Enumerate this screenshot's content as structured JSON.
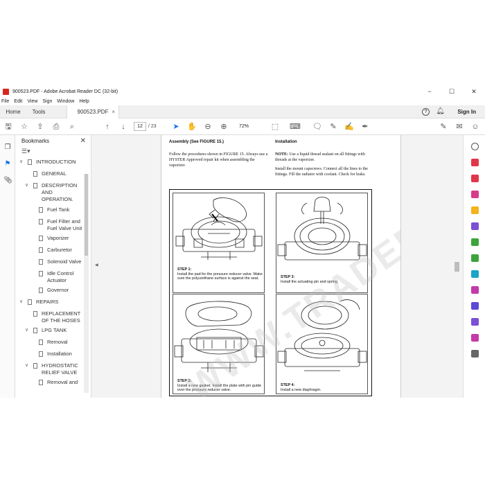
{
  "window": {
    "title": "900523.PDF - Adobe Acrobat Reader DC (32-bit)",
    "min": "−",
    "max": "☐",
    "close": "✕"
  },
  "menu": [
    "File",
    "Edit",
    "View",
    "Sign",
    "Window",
    "Help"
  ],
  "tabs": {
    "home": "Home",
    "tools": "Tools",
    "document": "900523.PDF",
    "close": "×"
  },
  "header": {
    "help": "?",
    "sign_in": "Sign In"
  },
  "toolbar": {
    "page_current": "12",
    "page_total": "/ 23",
    "zoom": "72%"
  },
  "bookmarks": {
    "title": "Bookmarks",
    "items": [
      {
        "label": "INTRODUCTION",
        "level": 0,
        "expanded": true
      },
      {
        "label": "GENERAL",
        "level": 1
      },
      {
        "label": "DESCRIPTION AND OPERATION.",
        "level": 1,
        "expanded": true
      },
      {
        "label": "Fuel Tank",
        "level": 2
      },
      {
        "label": "Fuel Filter and Fuel Valve Unit",
        "level": 2
      },
      {
        "label": "Vaporizer",
        "level": 2
      },
      {
        "label": "Carburetor",
        "level": 2
      },
      {
        "label": "Solenoid Valve",
        "level": 2
      },
      {
        "label": "Idle Control Actuator",
        "level": 2
      },
      {
        "label": "Governor",
        "level": 2
      },
      {
        "label": "REPAIRS",
        "level": 0,
        "expanded": true
      },
      {
        "label": "REPLACEMENT OF THE HOSES",
        "level": 1
      },
      {
        "label": "LPG TANK",
        "level": 1,
        "expanded": true
      },
      {
        "label": "Removal",
        "level": 2
      },
      {
        "label": "Installation",
        "level": 2
      },
      {
        "label": "HYDROSTATIC RELIEF VALVE",
        "level": 1,
        "expanded": true
      },
      {
        "label": "Removal and",
        "level": 2
      }
    ]
  },
  "page": {
    "left_heading": "Assembly (See FIGURE 15.)",
    "left_text": "Follow the procedures shown in FIGURE 15. Always use a HYSTER Approved repair kit when assembling the vaporizer.",
    "right_heading": "Installation",
    "right_note_label": "NOTE:",
    "right_note": " Use a liquid thread sealant on all fittings with threads at the vaporizer.",
    "right_text": "Install the mount capscrews. Connect all the lines to the fittings. Fill the radiator with coolant. Check for leaks.",
    "watermark": "WWW.TRADEPO.COM",
    "steps": [
      {
        "title": "STEP 1:",
        "text": "Install the pad for the pressure reducer valve. Make sure the polyurethane surface is against the seat."
      },
      {
        "title": "STEP 3:",
        "text": "Install the actuating pin and spring."
      },
      {
        "title": "STEP 2:",
        "text": "Install a new gasket. Install the plate with pin guide over the pressure reducer valve."
      },
      {
        "title": "STEP 4:",
        "text": "Install a new diaphragm."
      }
    ]
  }
}
